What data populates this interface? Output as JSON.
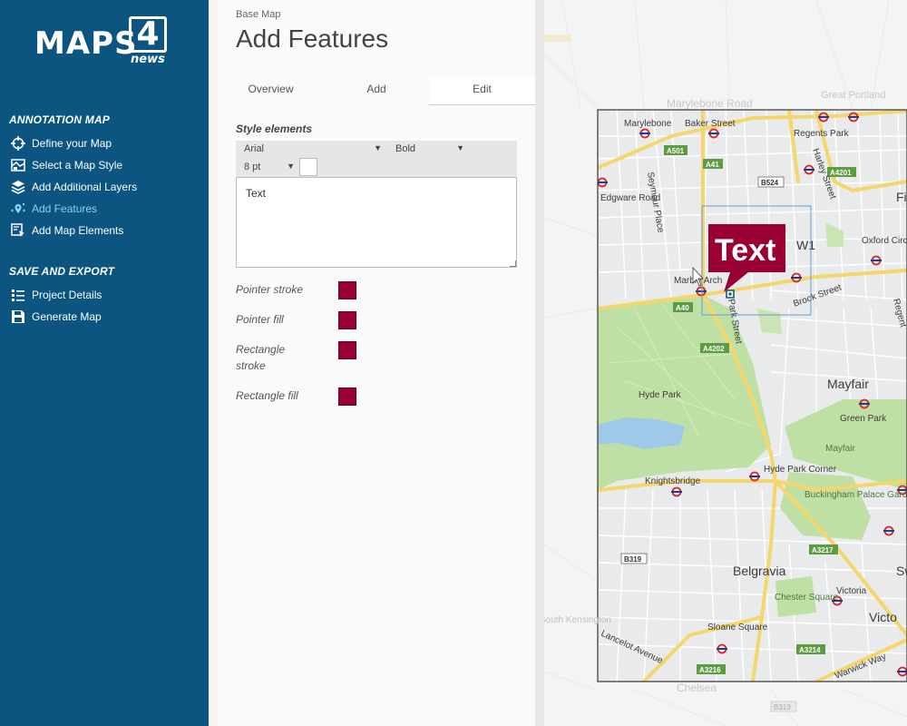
{
  "brand": {
    "word": "MAPS",
    "num": "4",
    "sub": "news"
  },
  "sidebar": {
    "annotation_title": "ANNOTATION MAP",
    "items": [
      {
        "label": "Define your Map",
        "icon": "crosshair-icon"
      },
      {
        "label": "Select a Map Style",
        "icon": "map-style-icon"
      },
      {
        "label": "Add Additional Layers",
        "icon": "layers-icon"
      },
      {
        "label": "Add Features",
        "icon": "location-pin-icon",
        "active": true
      },
      {
        "label": "Add Map Elements",
        "icon": "map-elements-icon"
      }
    ],
    "export_title": "SAVE AND EXPORT",
    "export_items": [
      {
        "label": "Project Details",
        "icon": "list-icon"
      },
      {
        "label": "Generate Map",
        "icon": "save-icon"
      }
    ]
  },
  "panel": {
    "breadcrumb": "Base Map",
    "title": "Add Features",
    "tabs": [
      "Overview",
      "Add",
      "Edit"
    ],
    "active_tab": "Edit",
    "style_title": "Style elements",
    "font": "Arial",
    "weight": "Bold",
    "size": "8 pt",
    "text_value": "Text",
    "props": [
      {
        "label": "Pointer stroke",
        "color": "#990033"
      },
      {
        "label": "Pointer fill",
        "color": "#990033"
      },
      {
        "label": "Rectangle stroke",
        "color": "#990033"
      },
      {
        "label": "Rectangle fill",
        "color": "#990033"
      }
    ]
  },
  "map": {
    "callout_text": "Text",
    "labels": [
      "Marylebone",
      "Baker Street",
      "Regents Park",
      "Edgware Road",
      "Seymour Place",
      "Harley Street",
      "Oxford Circus",
      "Marble Arch",
      "Park Street",
      "Brook Street",
      "Regent",
      "Hyde Park",
      "Mayfair",
      "Green Park",
      "Knightsbridge",
      "Hyde Park Corner",
      "Buckingham Palace Gardens",
      "Belgravia",
      "Chester Square",
      "Victoria",
      "Sloane Square",
      "Lancelot Avenue",
      "Warwick Way",
      "W1",
      "Fi",
      "Sw",
      "Victo",
      "Chelsea",
      "South Kensington",
      "Great Portland",
      "Marylebone Road"
    ],
    "road_badges": [
      "A501",
      "A41",
      "B524",
      "A4201",
      "A40",
      "A4202",
      "B319",
      "A3217",
      "A3214",
      "A3216",
      "B313"
    ]
  }
}
